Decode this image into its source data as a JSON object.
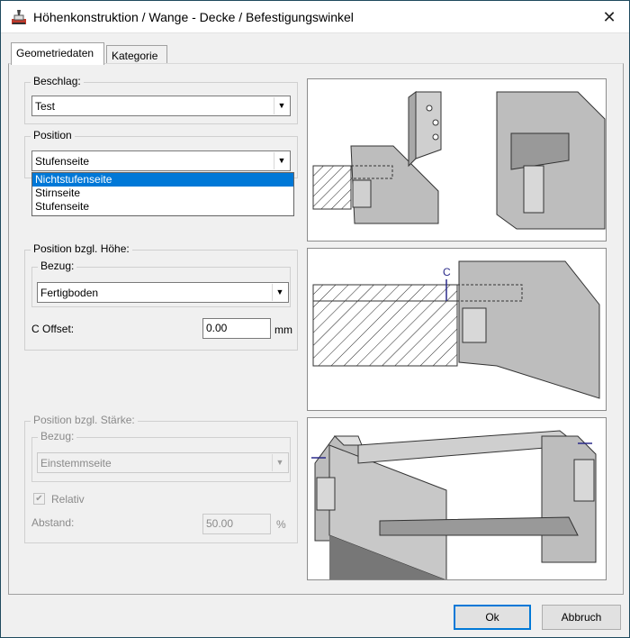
{
  "window": {
    "title": "Höhenkonstruktion / Wange - Decke / Befestigungswinkel",
    "close_glyph": "✕"
  },
  "tabs": [
    {
      "label": "Geometriedaten"
    },
    {
      "label": "Kategorie"
    }
  ],
  "beschlag": {
    "title": "Beschlag:",
    "value": "Test"
  },
  "position": {
    "title": "Position",
    "value": "Stufenseite",
    "options": [
      "Nichtstufenseite",
      "Stirnseite",
      "Stufenseite"
    ],
    "highlighted": "Nichtstufenseite"
  },
  "hoehe": {
    "title": "Position bzgl. Höhe:",
    "bezug_title": "Bezug:",
    "bezug_value": "Fertigboden",
    "offset_label": "C Offset:",
    "offset_value": "0.00",
    "offset_unit": "mm"
  },
  "staerke": {
    "title": "Position bzgl. Stärke:",
    "bezug_title": "Bezug:",
    "bezug_value": "Einstemmseite",
    "relativ_label": "Relativ",
    "relativ_checked": true,
    "abstand_label": "Abstand:",
    "abstand_value": "50.00",
    "abstand_unit": "%"
  },
  "preview2": {
    "dimension_label": "C"
  },
  "buttons": {
    "ok": "Ok",
    "cancel": "Abbruch"
  },
  "colors": {
    "selection": "#0078d7",
    "title_border": "#1f4a5e",
    "drawing_gray": "#bdbdbd"
  }
}
